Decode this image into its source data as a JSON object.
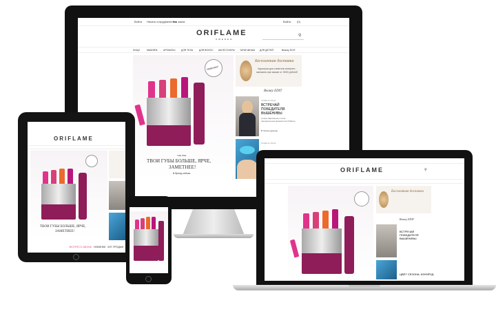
{
  "site": {
    "logo": "ORIFLAME",
    "logo_sub": "SWEDEN",
    "top_links": [
      "Войти",
      "Начать сотрудничество",
      "Как заказ"
    ],
    "account": "Войти",
    "cart": "(0)",
    "nav": [
      "ЛИЦО",
      "МАКИЯЖ",
      "АРОМАТЫ",
      "ДЛЯ ТЕЛА",
      "ДЛЯ ВОЛОС",
      "АКСЕССУАРЫ",
      "МУЖЧИНАМ",
      "ДЛЯ ДЕТЕЙ",
      "Beauty EDIT"
    ]
  },
  "hero": {
    "badge": "Новинка!",
    "subtitle": "THE ONE",
    "title_line1": "ТВОИ ГУБЫ БОЛЬШЕ, ЯРЧЕ,",
    "title_line2": "ЗАМЕТНЕЕ!",
    "cta": "В бренд сейчас"
  },
  "promo": {
    "title": "Бесплатная доставка",
    "text": "Курьером для клиентов интернет-магазина при заказе от 3000 рублей!"
  },
  "beauty_edit": {
    "title": "Beauty EDIT",
    "story1_tag": "ЗАМЕНА ЛИЦА",
    "story1_title": "ВСТРЕЧАЙ ПОБЕДИТЕЛЯ ВЫШЕНИВЫ",
    "story1_text": "Алена Пархоменко стала официальным визажистом Oriflame",
    "story1_link": "В Читать дальше",
    "story2_tag": "ЗАМЕНА ЛИЦА",
    "story2_title": "ЦВЕТ СЕЗОНА: ИЗУМРУД"
  },
  "tablet": {
    "tabs": [
      "ЭКСПРЕСС-ВИЗАЖ",
      "НОВИНКИ",
      "ХИТ ПРОДАЖ"
    ]
  },
  "colors": {
    "accent": "#e84c86",
    "lip_colors": [
      "#e0338b",
      "#d8407a",
      "#ec6a2c",
      "#b8167a",
      "#8a1a5e"
    ],
    "tube": "#8e1d59"
  }
}
